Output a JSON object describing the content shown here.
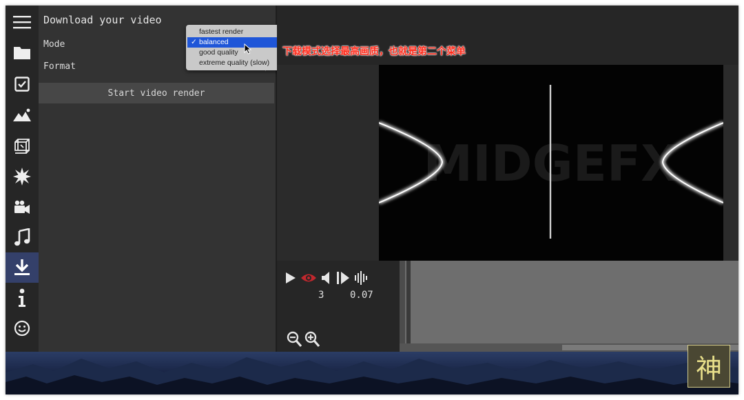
{
  "panel": {
    "title": "Download your video",
    "mode_label": "Mode",
    "format_label": "Format",
    "start_button": "Start video render"
  },
  "mode_menu": {
    "options": [
      "fastest render",
      "balanced",
      "good quality",
      "extreme quality (slow)"
    ],
    "selected": "balanced",
    "check": "✓"
  },
  "annotation": "下载模式选择最高画质，也就是第二个菜单",
  "video": {
    "watermark": "MIDGEFX"
  },
  "playback": {
    "frame": "3",
    "time": "0.07"
  },
  "sidebar": {
    "icons": [
      "menu-icon",
      "folder-icon",
      "checkbox-icon",
      "image-icon",
      "cube-icon",
      "burst-icon",
      "camera-icon",
      "music-icon",
      "download-icon",
      "info-icon",
      "smiley-icon"
    ],
    "active": "download-icon"
  },
  "seal_text": "神",
  "colors": {
    "accent_active": "#34406a",
    "menu_selected": "#1f56d8",
    "annotation": "#ff2a1a",
    "eye_icon": "#c0272d"
  }
}
